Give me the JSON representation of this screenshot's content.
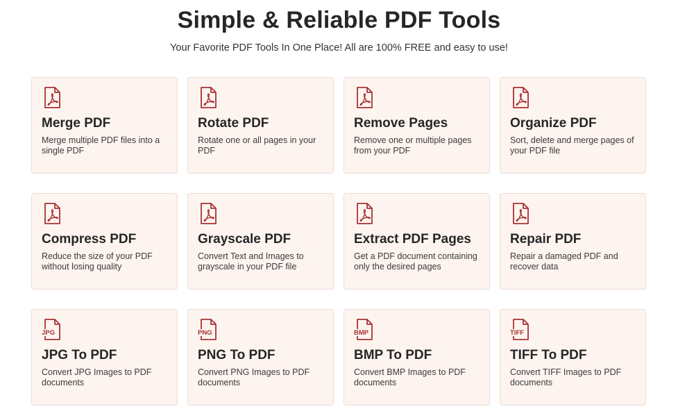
{
  "header": {
    "title": "Simple & Reliable PDF Tools",
    "subtitle": "Your Favorite PDF Tools In One Place! All are 100% FREE and easy to use!"
  },
  "colors": {
    "icon_red": "#a83232",
    "card_bg": "#fdf4f0",
    "card_border": "#ecdcd5"
  },
  "tools": [
    {
      "icon": "pdf-file-icon",
      "icon_text": "",
      "title": "Merge PDF",
      "desc": "Merge multiple PDF files into a single PDF"
    },
    {
      "icon": "pdf-file-icon",
      "icon_text": "",
      "title": "Rotate PDF",
      "desc": "Rotate one or all pages in your PDF"
    },
    {
      "icon": "pdf-file-icon",
      "icon_text": "",
      "title": "Remove Pages",
      "desc": "Remove one or multiple pages from your PDF"
    },
    {
      "icon": "pdf-file-icon",
      "icon_text": "",
      "title": "Organize PDF",
      "desc": "Sort, delete and merge pages of your PDF file"
    },
    {
      "icon": "pdf-file-icon",
      "icon_text": "",
      "title": "Compress PDF",
      "desc": "Reduce the size of your PDF without losing quality"
    },
    {
      "icon": "pdf-file-icon",
      "icon_text": "",
      "title": "Grayscale PDF",
      "desc": "Convert Text and Images to grayscale in your PDF file"
    },
    {
      "icon": "pdf-file-icon",
      "icon_text": "",
      "title": "Extract PDF Pages",
      "desc": "Get a PDF document containing only the desired pages"
    },
    {
      "icon": "pdf-file-icon",
      "icon_text": "",
      "title": "Repair PDF",
      "desc": "Repair a damaged PDF and recover data"
    },
    {
      "icon": "jpg-file-icon",
      "icon_text": "JPG",
      "title": "JPG To PDF",
      "desc": "Convert JPG Images to PDF documents"
    },
    {
      "icon": "png-file-icon",
      "icon_text": "PNG",
      "title": "PNG To PDF",
      "desc": "Convert PNG Images to PDF documents"
    },
    {
      "icon": "bmp-file-icon",
      "icon_text": "BMP",
      "title": "BMP To PDF",
      "desc": "Convert BMP Images to PDF documents"
    },
    {
      "icon": "tiff-file-icon",
      "icon_text": "TIFF",
      "title": "TIFF To PDF",
      "desc": "Convert TIFF Images to PDF documents"
    }
  ]
}
